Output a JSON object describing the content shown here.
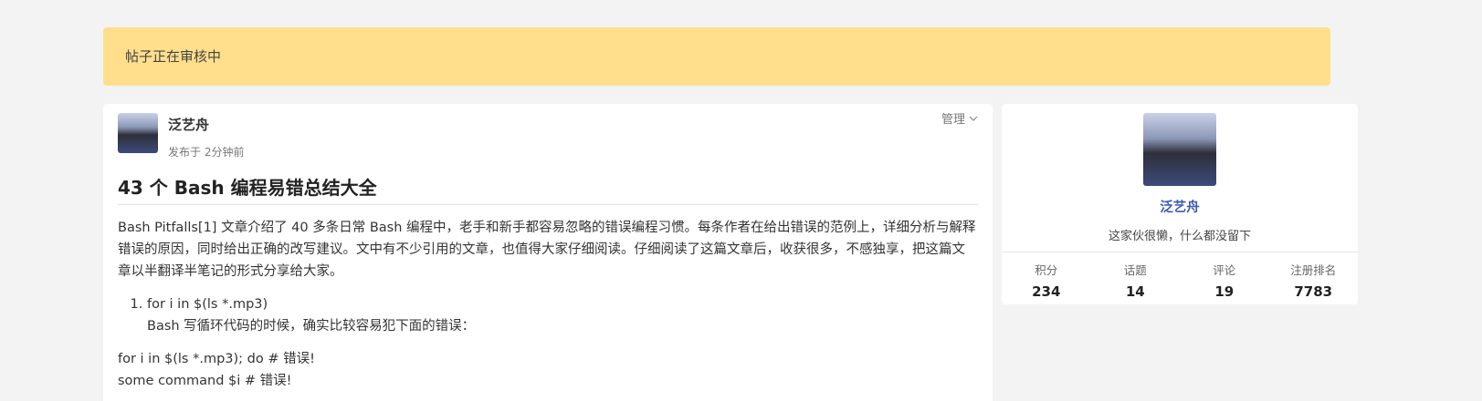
{
  "notice": {
    "text": "帖子正在审核中"
  },
  "post": {
    "author": "泛艺舟",
    "time": "发布于 2分钟前",
    "manage_label": "管理",
    "title": "43 个 Bash 编程易错总结大全",
    "intro": "Bash Pitfalls[1] 文章介绍了 40 多条日常 Bash 编程中，老手和新手都容易忽略的错误编程习惯。每条作者在给出错误的范例上，详细分析与解释错误的原因，同时给出正确的改写建议。文中有不少引用的文章，也值得大家仔细阅读。仔细阅读了这篇文章后，收获很多，不感独享，把这篇文章以半翻译半笔记的形式分享给大家。",
    "list": [
      {
        "heading": "for i in $(ls *.mp3)",
        "sub": "Bash 写循环代码的时候，确实比较容易犯下面的错误："
      }
    ],
    "code": [
      "for i in $(ls *.mp3); do # 错误!",
      "some command $i # 错误!"
    ]
  },
  "profile": {
    "name": "泛艺舟",
    "bio": "这家伙很懒，什么都没留下",
    "stats": [
      {
        "label": "积分",
        "value": "234"
      },
      {
        "label": "话题",
        "value": "14"
      },
      {
        "label": "评论",
        "value": "19"
      },
      {
        "label": "注册排名",
        "value": "7783"
      }
    ]
  }
}
